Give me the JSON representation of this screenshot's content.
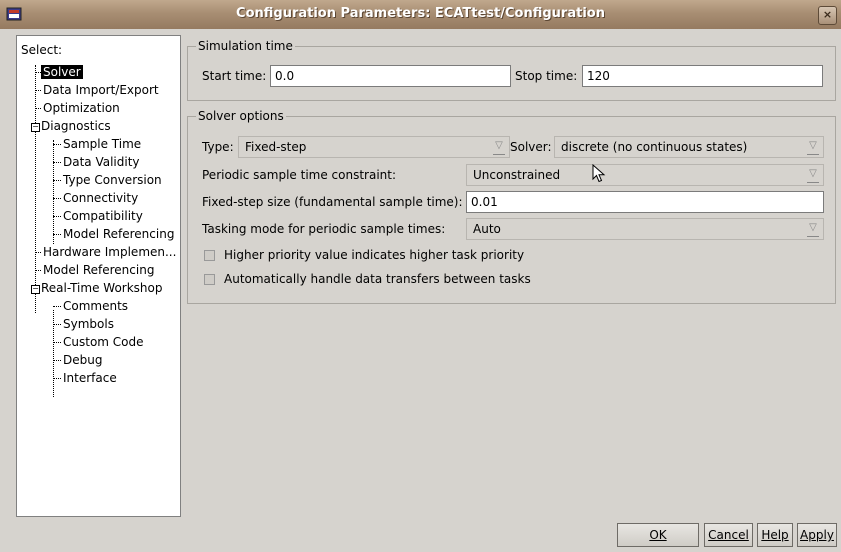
{
  "window": {
    "title": "Configuration Parameters: ECATtest/Configuration",
    "close_glyph": "×"
  },
  "tree": {
    "select_label": "Select:",
    "items": [
      {
        "label": "Solver",
        "selected": true
      },
      {
        "label": "Data Import/Export"
      },
      {
        "label": "Optimization"
      },
      {
        "label": "Diagnostics",
        "expander": "−"
      },
      {
        "label": "Sample Time"
      },
      {
        "label": "Data Validity"
      },
      {
        "label": "Type Conversion"
      },
      {
        "label": "Connectivity"
      },
      {
        "label": "Compatibility"
      },
      {
        "label": "Model Referencing"
      },
      {
        "label": "Hardware Implemen..."
      },
      {
        "label": "Model Referencing"
      },
      {
        "label": "Real-Time Workshop",
        "expander": "−"
      },
      {
        "label": "Comments"
      },
      {
        "label": "Symbols"
      },
      {
        "label": "Custom Code"
      },
      {
        "label": "Debug"
      },
      {
        "label": "Interface"
      }
    ]
  },
  "simulation_time": {
    "legend": "Simulation time",
    "start_label": "Start time:",
    "start_value": "0.0",
    "stop_label": "Stop time:",
    "stop_value": "120"
  },
  "solver_options": {
    "legend": "Solver options",
    "type_label": "Type:",
    "type_value": "Fixed-step",
    "solver_label": "Solver:",
    "solver_value": "discrete (no continuous states)",
    "periodic_label": "Periodic sample time constraint:",
    "periodic_value": "Unconstrained",
    "step_label": "Fixed-step size (fundamental sample time):",
    "step_value": "0.01",
    "tasking_label": "Tasking mode for periodic sample times:",
    "tasking_value": "Auto",
    "check1_label": "Higher priority value indicates higher task priority",
    "check2_label": "Automatically handle data transfers between tasks"
  },
  "buttons": {
    "ok": "OK",
    "cancel": "Cancel",
    "help": "Help",
    "apply": "Apply"
  },
  "colors": {
    "title_bar": "#a88e73",
    "panel": "#d6d3ce",
    "selection": "#000000"
  }
}
